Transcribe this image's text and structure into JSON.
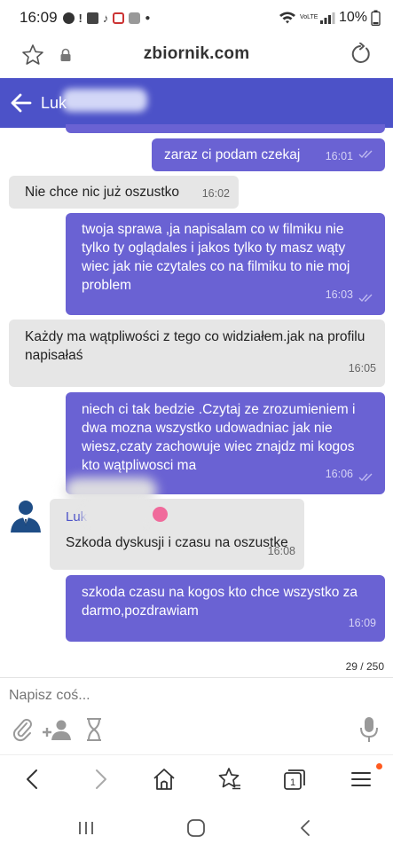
{
  "status_bar": {
    "time": "16:09",
    "network": "VoLTE",
    "battery": "10%"
  },
  "browser": {
    "url": "zbiornik.com"
  },
  "chat_header": {
    "contact_name": "Luk"
  },
  "messages": [
    {
      "side": "out",
      "text": "zaraz ci podam czekaj",
      "time": "16:01"
    },
    {
      "side": "in",
      "text": "Nie chce nic już oszustko",
      "time": "16:02"
    },
    {
      "side": "out",
      "text": "twoja sprawa ,ja napisalam co w filmiku nie tylko ty oglądales i jakos tylko ty masz wąty wiec jak nie czytales co na filmiku to nie moj problem",
      "time": "16:03"
    },
    {
      "side": "in",
      "text": "Każdy ma wątpliwości z tego co widziałem.jak na profilu napisałaś",
      "time": "16:05"
    },
    {
      "side": "out",
      "text": "niech ci tak bedzie .Czytaj ze zrozumieniem i dwa mozna wszystko udowadniac jak nie wiesz,czaty zachowuje wiec znajdz mi kogos kto wątpliwosci ma",
      "time": "16:06"
    },
    {
      "side": "in",
      "sender": "Luk",
      "text": "Szkoda dyskusji i czasu na oszustke",
      "time": "16:08"
    },
    {
      "side": "out",
      "text": "szkoda czasu na kogos kto chce wszystko za darmo,pozdrawiam",
      "time": "16:09"
    }
  ],
  "composer": {
    "counter": "29 / 250",
    "placeholder": "Napisz coś..."
  },
  "colors": {
    "header": "#4c52c8",
    "outgoing_bubble": "#6a62d3",
    "incoming_bubble": "#e6e6e6"
  }
}
